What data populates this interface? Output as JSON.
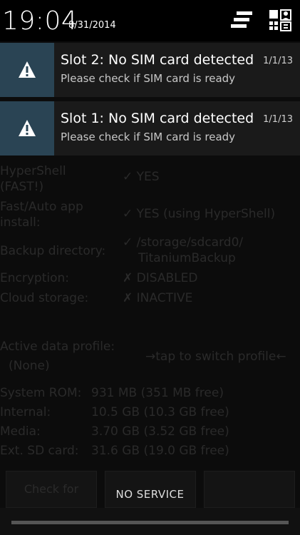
{
  "status_bar": {
    "time": "19:04",
    "date": "8/31/2014",
    "icons": [
      "settings-sliders-icon",
      "user-grid-icon"
    ]
  },
  "notifications": [
    {
      "title": "Slot 2: No SIM card detected",
      "subtitle": "Please check if SIM card is ready",
      "time": "1/1/13",
      "icon": "warning-icon"
    },
    {
      "title": "Slot 1: No SIM card detected",
      "subtitle": "Please check if SIM card is ready",
      "time": "1/1/13",
      "icon": "warning-icon"
    }
  ],
  "background_app": {
    "rows": [
      {
        "label": "HyperShell",
        "value": "✓ YES"
      },
      {
        "label": "(FAST!)",
        "value": ""
      },
      {
        "label": "Fast/Auto app",
        "value": "✓ YES (using HyperShell)"
      },
      {
        "label": "install:",
        "value": ""
      },
      {
        "label": "Backup directory:",
        "value": "✓ /storage/sdcard0/"
      },
      {
        "label": "",
        "value": "TitaniumBackup"
      },
      {
        "label": "Encryption:",
        "value": "✗ DISABLED"
      },
      {
        "label": "Cloud storage:",
        "value": "✗ INACTIVE"
      },
      {
        "label": "Active data profile:",
        "value": "→tap to switch profile←"
      },
      {
        "label": "(None)",
        "value": ""
      },
      {
        "label": "System ROM:",
        "value": "931 MB (351 MB free)"
      },
      {
        "label": "Internal:",
        "value": "10.5 GB (10.3 GB free)"
      },
      {
        "label": "Media:",
        "value": "3.70 GB (3.52 GB free)"
      },
      {
        "label": "Ext. SD card:",
        "value": "31.6 GB (19.0 GB free)"
      }
    ],
    "buttons": [
      "Check for",
      "",
      ""
    ]
  },
  "carrier_label": "NO SERVICE",
  "colors": {
    "notification_icon_bg": "#2a4454",
    "panel_bg": "#1a1a1a"
  }
}
